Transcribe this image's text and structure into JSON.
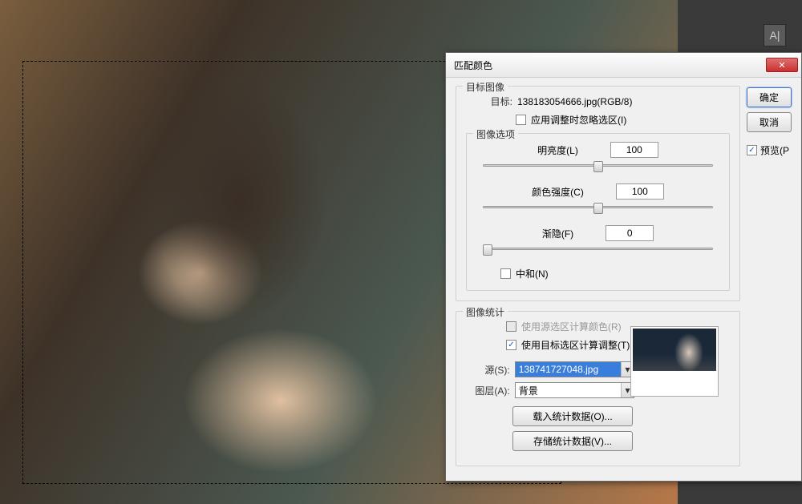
{
  "dialog": {
    "title": "匹配颜色",
    "buttons": {
      "ok": "确定",
      "cancel": "取消"
    },
    "preview_label": "预览(P"
  },
  "target_image": {
    "legend": "目标图像",
    "target_label": "目标:",
    "target_value": "138183054666.jpg(RGB/8)",
    "ignore_selection_label": "应用调整时忽略选区(I)"
  },
  "image_options": {
    "legend": "图像选项",
    "luminance": {
      "label": "明亮度(L)",
      "value": "100",
      "thumb_pct": 50
    },
    "intensity": {
      "label": "颜色强度(C)",
      "value": "100",
      "thumb_pct": 50
    },
    "fade": {
      "label": "渐隐(F)",
      "value": "0",
      "thumb_pct": 2
    },
    "neutralize_label": "中和(N)"
  },
  "image_stats": {
    "legend": "图像统计",
    "use_source_sel": "使用源选区计算颜色(R)",
    "use_target_sel": "使用目标选区计算调整(T)",
    "source_label": "源(S):",
    "source_value": "138741727048.jpg",
    "layer_label": "图层(A):",
    "layer_value": "背景",
    "load_stats": "载入统计数据(O)...",
    "save_stats": "存储统计数据(V)..."
  },
  "toolbar": {
    "tool": "A|"
  }
}
